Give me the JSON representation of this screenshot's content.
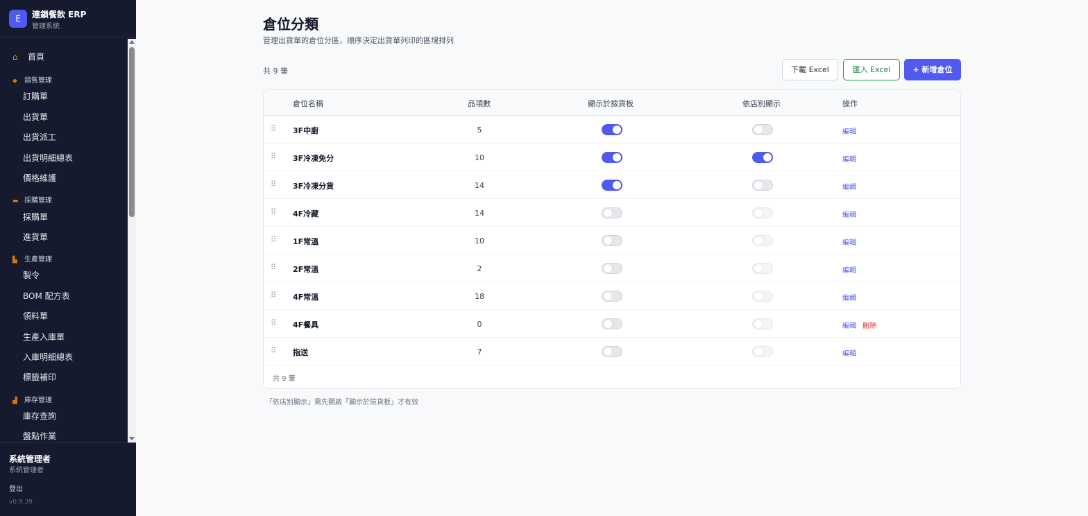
{
  "sidebar": {
    "brand_logo": "E",
    "brand_title": "連鎖餐飲 ERP",
    "brand_sub": "管理系統",
    "home": "首頁",
    "groups": [
      {
        "label": "銷售管理",
        "items": [
          "訂購單",
          "出貨單",
          "出貨派工",
          "出貨明細總表",
          "價格維護"
        ]
      },
      {
        "label": "採購管理",
        "items": [
          "採購單",
          "進貨單"
        ]
      },
      {
        "label": "生產管理",
        "items": [
          "製令",
          "BOM 配方表",
          "領料單",
          "生產入庫單",
          "入庫明細總表",
          "標籤補印"
        ]
      },
      {
        "label": "庫存管理",
        "items": [
          "庫存查詢",
          "盤點作業"
        ]
      }
    ],
    "user_name": "系統管理者",
    "user_role": "系統管理者",
    "logout": "登出",
    "version": "v0.9.39"
  },
  "page": {
    "title": "倉位分類",
    "description": "管理出貨單的倉位分區，順序決定出貨單列印的區塊排列",
    "count_label": "共 9 筆",
    "buttons": {
      "download": "下載 Excel",
      "import": "匯入 Excel",
      "add": "+ 新增倉位"
    },
    "note": "「依店別顯示」需先開啟「顯示於撿貨板」才有效"
  },
  "table": {
    "headers": {
      "name": "倉位名稱",
      "count": "品項數",
      "show": "顯示於撿貨板",
      "store": "依店別顯示",
      "ops": "操作"
    },
    "edit_label": "編輯",
    "delete_label": "刪除",
    "footer": "共 9 筆",
    "rows": [
      {
        "name": "3F中廚",
        "count": "5",
        "show": true,
        "store": false,
        "deletable": false
      },
      {
        "name": "3F冷凍免分",
        "count": "10",
        "show": true,
        "store": true,
        "deletable": false
      },
      {
        "name": "3F冷凍分貨",
        "count": "14",
        "show": true,
        "store": false,
        "deletable": false
      },
      {
        "name": "4F冷藏",
        "count": "14",
        "show": false,
        "store": false,
        "deletable": false
      },
      {
        "name": "1F常溫",
        "count": "10",
        "show": false,
        "store": false,
        "deletable": false
      },
      {
        "name": "2F常溫",
        "count": "2",
        "show": false,
        "store": false,
        "deletable": false
      },
      {
        "name": "4F常溫",
        "count": "18",
        "show": false,
        "store": false,
        "deletable": false
      },
      {
        "name": "4F餐具",
        "count": "0",
        "show": false,
        "store": false,
        "deletable": true
      },
      {
        "name": "指送",
        "count": "7",
        "show": false,
        "store": false,
        "deletable": false
      }
    ]
  },
  "colors": {
    "accent": "#4f5af0",
    "sidebar_bg": "#161a2e",
    "import_green": "#16a34a",
    "delete_red": "#dc2626"
  }
}
